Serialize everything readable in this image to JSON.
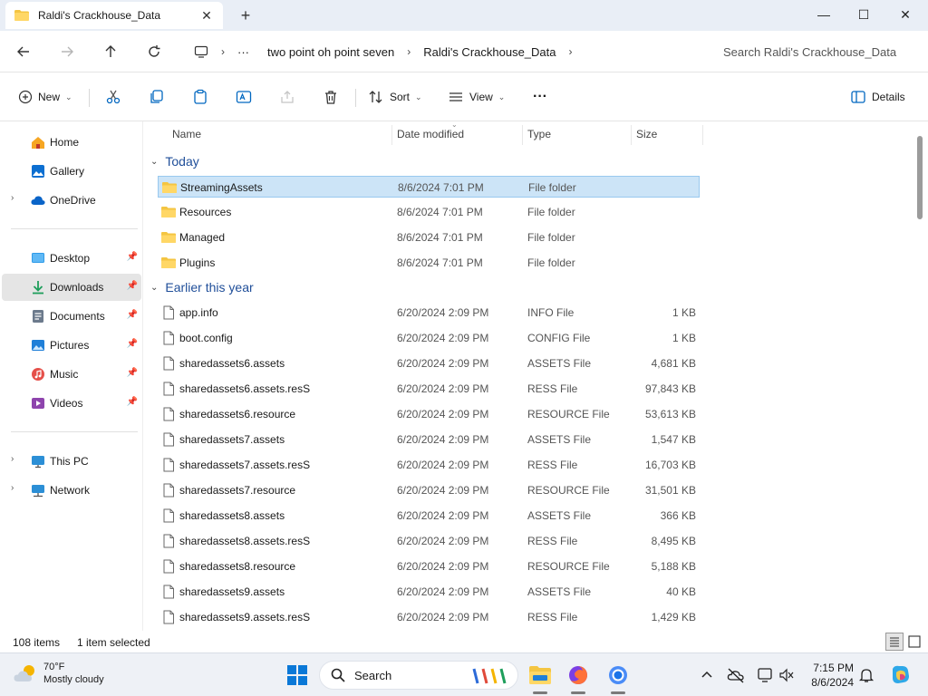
{
  "window": {
    "tab_title": "Raldi's Crackhouse_Data",
    "tab_close": "✕",
    "new_tab": "+",
    "minimize": "—",
    "maximize": "☐",
    "close": "✕"
  },
  "address": {
    "ellipsis": "···",
    "crumbs": [
      "two point oh point seven",
      "Raldi's Crackhouse_Data"
    ],
    "search_placeholder": "Search Raldi's Crackhouse_Data"
  },
  "toolbar": {
    "new_label": "New",
    "sort_label": "Sort",
    "view_label": "View",
    "more_label": "···",
    "details_label": "Details"
  },
  "sidebar": {
    "items": [
      {
        "label": "Home",
        "icon": "home-icon"
      },
      {
        "label": "Gallery",
        "icon": "gallery-icon"
      },
      {
        "label": "OneDrive",
        "icon": "cloud-icon"
      },
      {
        "label": "Desktop",
        "icon": "desktop-icon"
      },
      {
        "label": "Downloads",
        "icon": "download-icon"
      },
      {
        "label": "Documents",
        "icon": "document-icon"
      },
      {
        "label": "Pictures",
        "icon": "picture-icon"
      },
      {
        "label": "Music",
        "icon": "music-icon"
      },
      {
        "label": "Videos",
        "icon": "video-icon"
      },
      {
        "label": "This PC",
        "icon": "computer-icon"
      },
      {
        "label": "Network",
        "icon": "network-icon"
      }
    ]
  },
  "columns": {
    "name": "Name",
    "date": "Date modified",
    "type": "Type",
    "size": "Size"
  },
  "groups": {
    "today": "Today",
    "earlier": "Earlier this year"
  },
  "today_rows": [
    {
      "name": "StreamingAssets",
      "date": "8/6/2024 7:01 PM",
      "type": "File folder",
      "size": ""
    },
    {
      "name": "Resources",
      "date": "8/6/2024 7:01 PM",
      "type": "File folder",
      "size": ""
    },
    {
      "name": "Managed",
      "date": "8/6/2024 7:01 PM",
      "type": "File folder",
      "size": ""
    },
    {
      "name": "Plugins",
      "date": "8/6/2024 7:01 PM",
      "type": "File folder",
      "size": ""
    }
  ],
  "earlier_rows": [
    {
      "name": "app.info",
      "date": "6/20/2024 2:09 PM",
      "type": "INFO File",
      "size": "1 KB"
    },
    {
      "name": "boot.config",
      "date": "6/20/2024 2:09 PM",
      "type": "CONFIG File",
      "size": "1 KB"
    },
    {
      "name": "sharedassets6.assets",
      "date": "6/20/2024 2:09 PM",
      "type": "ASSETS File",
      "size": "4,681 KB"
    },
    {
      "name": "sharedassets6.assets.resS",
      "date": "6/20/2024 2:09 PM",
      "type": "RESS File",
      "size": "97,843 KB"
    },
    {
      "name": "sharedassets6.resource",
      "date": "6/20/2024 2:09 PM",
      "type": "RESOURCE File",
      "size": "53,613 KB"
    },
    {
      "name": "sharedassets7.assets",
      "date": "6/20/2024 2:09 PM",
      "type": "ASSETS File",
      "size": "1,547 KB"
    },
    {
      "name": "sharedassets7.assets.resS",
      "date": "6/20/2024 2:09 PM",
      "type": "RESS File",
      "size": "16,703 KB"
    },
    {
      "name": "sharedassets7.resource",
      "date": "6/20/2024 2:09 PM",
      "type": "RESOURCE File",
      "size": "31,501 KB"
    },
    {
      "name": "sharedassets8.assets",
      "date": "6/20/2024 2:09 PM",
      "type": "ASSETS File",
      "size": "366 KB"
    },
    {
      "name": "sharedassets8.assets.resS",
      "date": "6/20/2024 2:09 PM",
      "type": "RESS File",
      "size": "8,495 KB"
    },
    {
      "name": "sharedassets8.resource",
      "date": "6/20/2024 2:09 PM",
      "type": "RESOURCE File",
      "size": "5,188 KB"
    },
    {
      "name": "sharedassets9.assets",
      "date": "6/20/2024 2:09 PM",
      "type": "ASSETS File",
      "size": "40 KB"
    },
    {
      "name": "sharedassets9.assets.resS",
      "date": "6/20/2024 2:09 PM",
      "type": "RESS File",
      "size": "1,429 KB"
    }
  ],
  "status": {
    "items": "108 items",
    "selected": "1 item selected"
  },
  "taskbar": {
    "temp": "70°F",
    "weather": "Mostly cloudy",
    "search": "Search",
    "time": "7:15 PM",
    "date": "8/6/2024"
  },
  "colors": {
    "folder": "#f4c542",
    "accent": "#0067c0",
    "selection": "#cce4f7",
    "group_header": "#1f4e99"
  }
}
